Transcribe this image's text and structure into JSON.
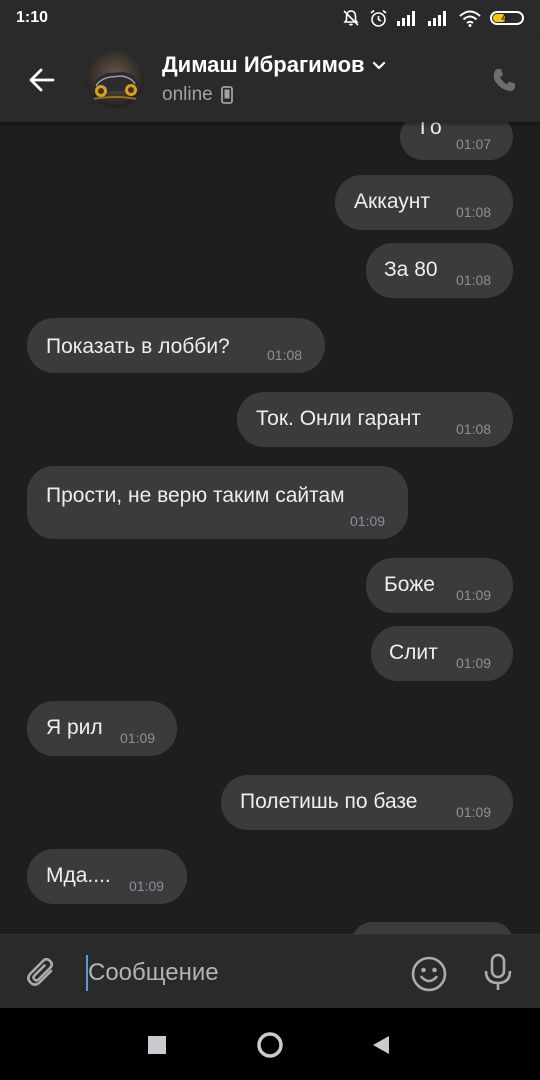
{
  "status_bar": {
    "time": "1:10",
    "battery": "47",
    "battery_level": 0.47
  },
  "header": {
    "contact_name": "Димаш Ибрагимов",
    "status": "online"
  },
  "messages": [
    {
      "text": "Го",
      "time": "01:07",
      "direction": "outgoing"
    },
    {
      "text": "Аккаунт",
      "time": "01:08",
      "direction": "outgoing"
    },
    {
      "text": "За 80",
      "time": "01:08",
      "direction": "outgoing"
    },
    {
      "text": "Показать в лобби?",
      "time": "01:08",
      "direction": "incoming"
    },
    {
      "text": "Ток. Онли гарант",
      "time": "01:08",
      "direction": "outgoing"
    },
    {
      "text": "Прости, не верю таким сайтам",
      "time": "01:09",
      "direction": "incoming"
    },
    {
      "text": "Боже",
      "time": "01:09",
      "direction": "outgoing"
    },
    {
      "text": "Слит",
      "time": "01:09",
      "direction": "outgoing"
    },
    {
      "text": "Я рил",
      "time": "01:09",
      "direction": "incoming"
    },
    {
      "text": "Полетишь по базе",
      "time": "01:09",
      "direction": "outgoing"
    },
    {
      "text": "Мда....",
      "time": "01:09",
      "direction": "incoming"
    }
  ],
  "composer": {
    "placeholder": "Сообщение"
  },
  "icons": {
    "back": "arrow-left-icon",
    "dropdown": "chevron-down-icon",
    "mobile": "mobile-device-icon",
    "call": "phone-icon",
    "attach": "paperclip-icon",
    "emoji": "emoji-icon",
    "mic": "microphone-icon",
    "nav_recents": "square-icon",
    "nav_home": "circle-icon",
    "nav_back": "triangle-back-icon"
  },
  "colors": {
    "background": "#1e1e1e",
    "bar": "#2a2a2a",
    "bubble": "#3a3b3d",
    "cursor": "#5b9bd5",
    "battery": "#f5c518"
  }
}
